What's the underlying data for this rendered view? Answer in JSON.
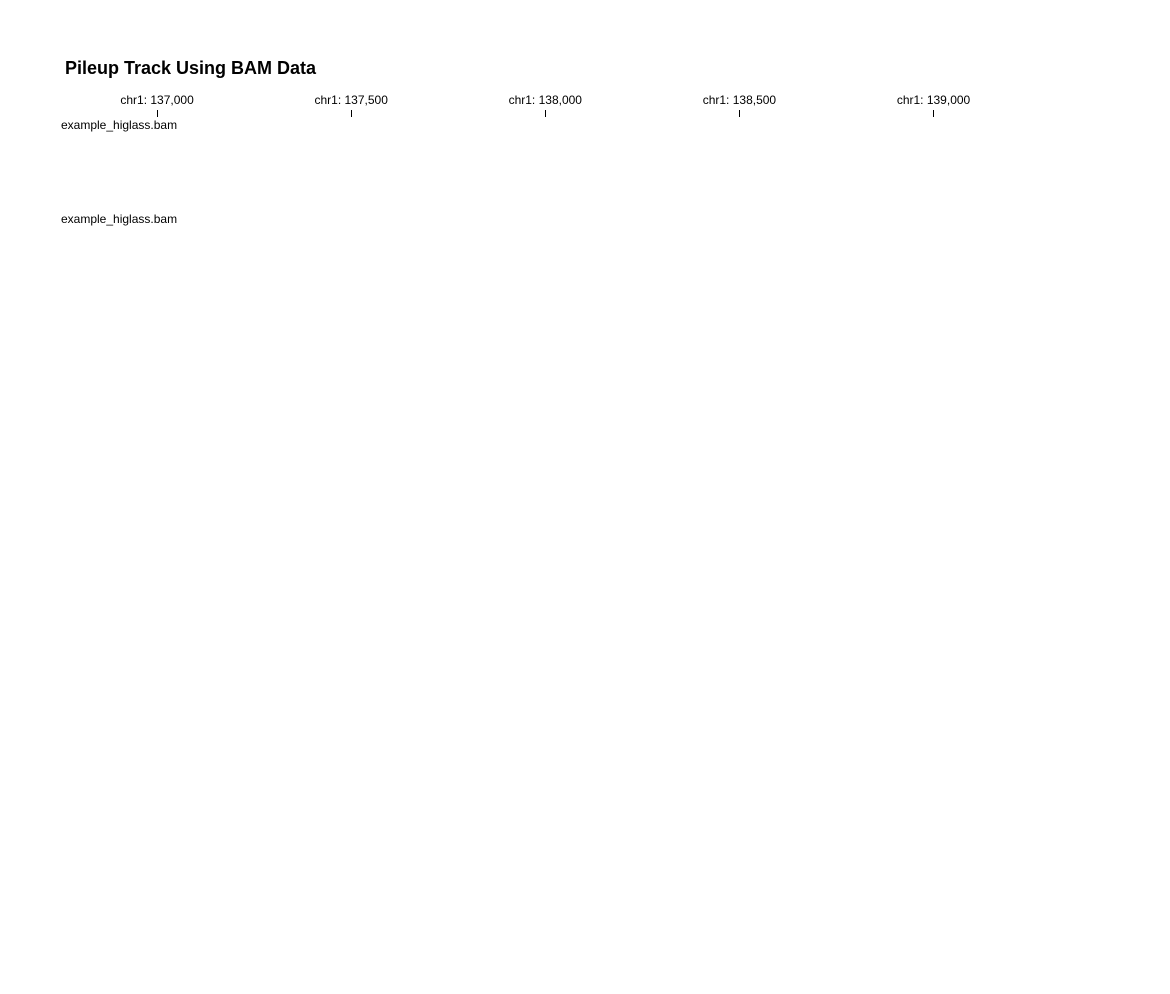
{
  "title": "Pileup Track Using BAM Data",
  "axis": {
    "ticks": [
      {
        "label": "chr1: 137,000",
        "position": 137000
      },
      {
        "label": "chr1: 137,500",
        "position": 137500
      },
      {
        "label": "chr1: 138,000",
        "position": 138000
      },
      {
        "label": "chr1: 138,500",
        "position": 138500
      },
      {
        "label": "chr1: 139,000",
        "position": 139000
      }
    ],
    "domain": [
      136750,
      139300
    ]
  },
  "tracks": [
    {
      "label": "example_higlass.bam"
    },
    {
      "label": "example_higlass.bam"
    }
  ],
  "colors": {
    "text": "#000000",
    "background": "#ffffff"
  }
}
